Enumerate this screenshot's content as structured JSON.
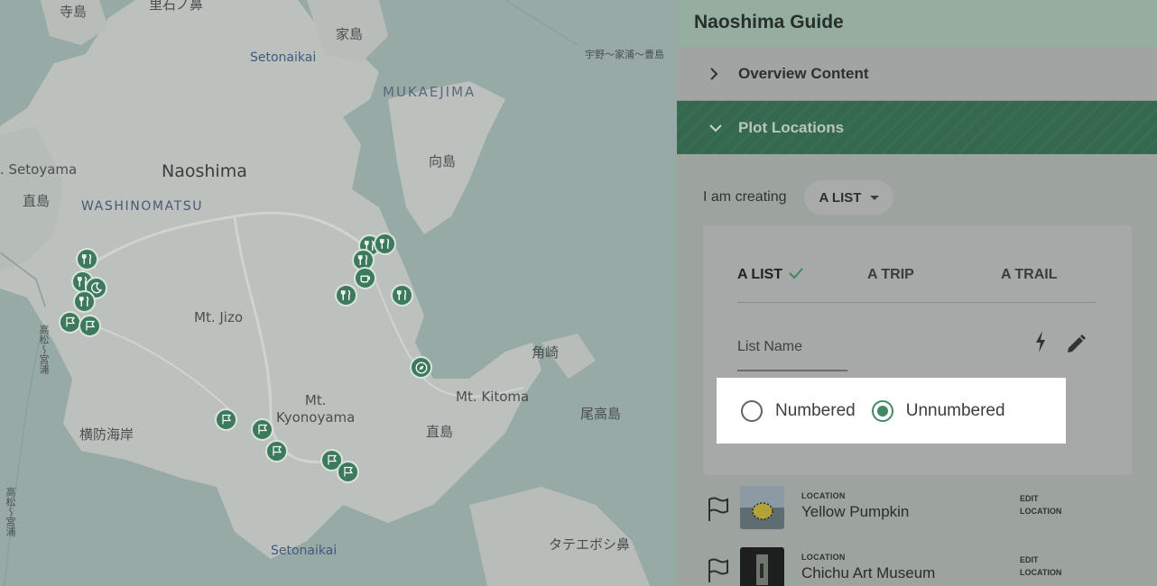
{
  "map": {
    "labels": {
      "terashima": "寺島",
      "top_cut": "里石ノ鼻",
      "ieshima": "家島",
      "setonaikai_top": "Setonaikai",
      "mukaejima": "MUKAEJIMA",
      "uno": "宇野～家浦～豊島",
      "setoyama": ". Setoyama",
      "naoshima": "Naoshima",
      "mukoshima": "向島",
      "naoshima_kanji_left": "直島",
      "washinomatsu": "WASHINOMATSU",
      "mt_jizo": "Mt. Jizo",
      "kakuzaki": "角崎",
      "mt_kitoma": "Mt. Kitoma",
      "mt_kyonoyama": "Mt.\nKyonoyama",
      "odakashima": "尾高島",
      "yokobo": "横防海岸",
      "naoshima_kanji_center": "直島",
      "tatebo": "タテエボシ鼻",
      "setonaikai_bottom": "Setonaikai",
      "route_left": "高松～宮浦",
      "route_left2": "高松～宮浦"
    },
    "pins": [
      {
        "icon": "fork-knife-icon"
      },
      {
        "icon": "fork-knife-icon"
      },
      {
        "icon": "moon-icon"
      },
      {
        "icon": "fork-knife-icon"
      },
      {
        "icon": "flag-icon"
      },
      {
        "icon": "flag-icon"
      },
      {
        "icon": "fork-knife-icon"
      },
      {
        "icon": "fork-knife-icon"
      },
      {
        "icon": "fork-knife-icon"
      },
      {
        "icon": "coffee-cup-icon"
      },
      {
        "icon": "fork-knife-icon"
      },
      {
        "icon": "fork-knife-icon"
      },
      {
        "icon": "compass-icon"
      },
      {
        "icon": "flag-icon"
      },
      {
        "icon": "flag-icon"
      },
      {
        "icon": "flag-icon"
      },
      {
        "icon": "flag-icon"
      },
      {
        "icon": "flag-icon"
      }
    ]
  },
  "panel": {
    "title": "Naoshima Guide",
    "overview_label": "Overview Content",
    "plot_label": "Plot Locations",
    "creating_label": "I am creating",
    "creating_value": "A LIST",
    "tabs": [
      "A LIST",
      "A TRIP",
      "A TRAIL"
    ],
    "active_tab": "A LIST",
    "list_name_placeholder": "List Name",
    "radio_numbered": "Numbered",
    "radio_unnumbered": "Unnumbered",
    "selected_radio": "Unnumbered",
    "locations": [
      {
        "kicker": "LOCATION",
        "name": "Yellow Pumpkin",
        "edit": "EDIT\nLOCATION"
      },
      {
        "kicker": "LOCATION",
        "name": "Chichu Art Museum",
        "edit": "EDIT\nLOCATION"
      }
    ]
  },
  "colors": {
    "accent_green": "#3f8a63",
    "pin_green": "#3d7a5c",
    "header_green": "#95ae9f"
  }
}
